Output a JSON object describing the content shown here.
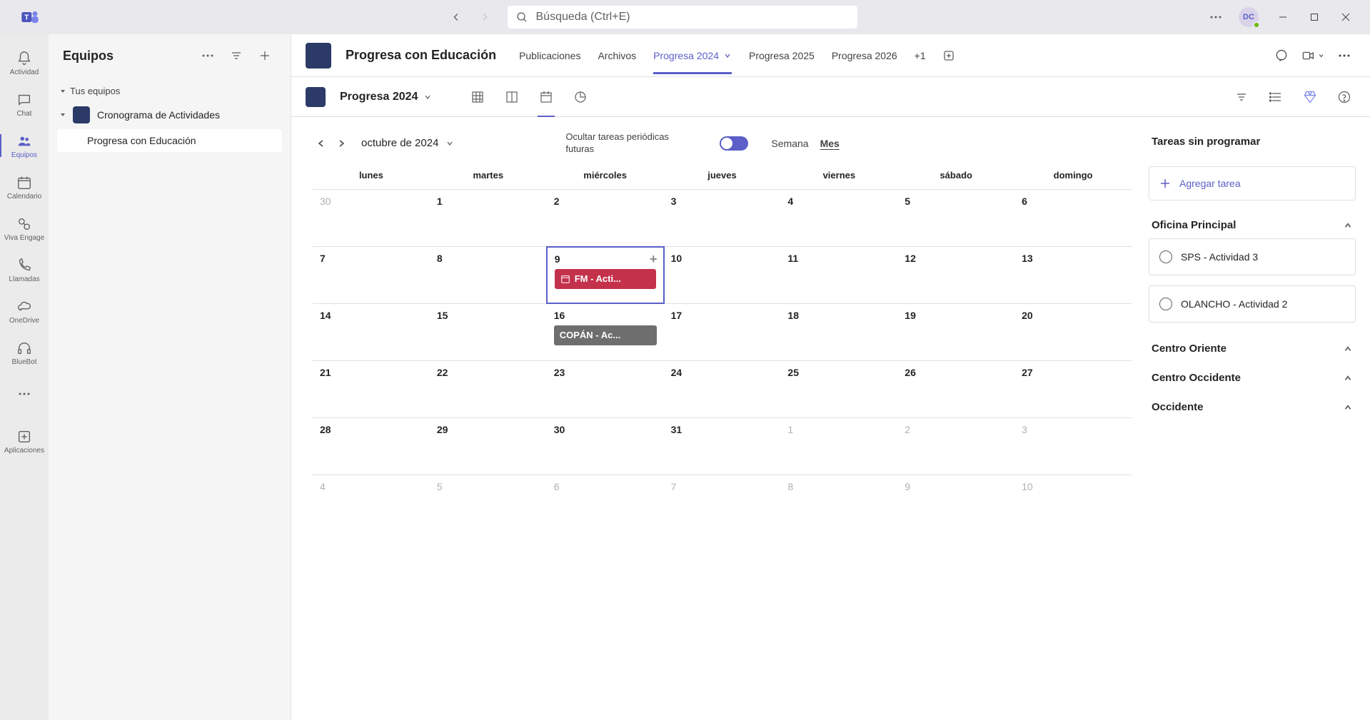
{
  "search": {
    "placeholder": "Búsqueda (Ctrl+E)"
  },
  "avatar_initials": "DC",
  "rail": {
    "actividad": "Actividad",
    "chat": "Chat",
    "equipos": "Equipos",
    "calendario": "Calendario",
    "viva": "Viva Engage",
    "llamadas": "Llamadas",
    "onedrive": "OneDrive",
    "bluebot": "BlueBot",
    "apps": "Aplicaciones"
  },
  "panel": {
    "title": "Equipos",
    "group_label": "Tus equipos",
    "team": "Cronograma de Actividades",
    "channel": "Progresa con Educación"
  },
  "header": {
    "title": "Progresa con Educación",
    "tabs": {
      "pub": "Publicaciones",
      "arch": "Archivos",
      "p2024": "Progresa 2024",
      "p2025": "Progresa 2025",
      "p2026": "Progresa 2026",
      "more": "+1"
    }
  },
  "plan": {
    "name": "Progresa 2024"
  },
  "calendar": {
    "month_label": "octubre de 2024",
    "recurring_label": "Ocultar tareas periódicas futuras",
    "week_label": "Semana",
    "month_view_label": "Mes",
    "dow": [
      "lunes",
      "martes",
      "miércoles",
      "jueves",
      "viernes",
      "sábado",
      "domingo"
    ],
    "weeks": [
      [
        {
          "n": "30",
          "other": true
        },
        {
          "n": "1"
        },
        {
          "n": "2"
        },
        {
          "n": "3"
        },
        {
          "n": "4"
        },
        {
          "n": "5"
        },
        {
          "n": "6"
        }
      ],
      [
        {
          "n": "7"
        },
        {
          "n": "8"
        },
        {
          "n": "9",
          "today": true,
          "event": {
            "label": "FM - Acti...",
            "cls": "ev-red",
            "icon": true
          }
        },
        {
          "n": "10"
        },
        {
          "n": "11"
        },
        {
          "n": "12"
        },
        {
          "n": "13"
        }
      ],
      [
        {
          "n": "14"
        },
        {
          "n": "15"
        },
        {
          "n": "16",
          "event": {
            "label": "COPÁN - Ac...",
            "cls": "ev-gray"
          }
        },
        {
          "n": "17"
        },
        {
          "n": "18"
        },
        {
          "n": "19"
        },
        {
          "n": "20"
        }
      ],
      [
        {
          "n": "21"
        },
        {
          "n": "22"
        },
        {
          "n": "23"
        },
        {
          "n": "24"
        },
        {
          "n": "25"
        },
        {
          "n": "26"
        },
        {
          "n": "27"
        }
      ],
      [
        {
          "n": "28"
        },
        {
          "n": "29"
        },
        {
          "n": "30"
        },
        {
          "n": "31"
        },
        {
          "n": "1",
          "other": true
        },
        {
          "n": "2",
          "other": true
        },
        {
          "n": "3",
          "other": true
        }
      ],
      [
        {
          "n": "4",
          "other": true
        },
        {
          "n": "5",
          "other": true
        },
        {
          "n": "6",
          "other": true
        },
        {
          "n": "7",
          "other": true
        },
        {
          "n": "8",
          "other": true
        },
        {
          "n": "9",
          "other": true
        },
        {
          "n": "10",
          "other": true
        }
      ]
    ]
  },
  "tasks": {
    "header": "Tareas sin programar",
    "add": "Agregar tarea",
    "buckets": [
      {
        "name": "Oficina Principal",
        "items": [
          "SPS - Actividad 3",
          "OLANCHO - Actividad 2"
        ]
      },
      {
        "name": "Centro Oriente",
        "items": []
      },
      {
        "name": "Centro Occidente",
        "items": []
      },
      {
        "name": "Occidente",
        "items": []
      }
    ]
  }
}
